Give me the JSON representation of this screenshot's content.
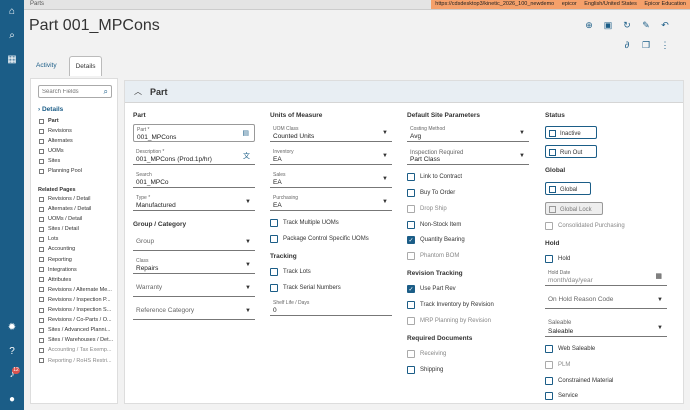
{
  "topbar": {
    "breadcrumb": "Parts",
    "url": "https://cdsdesktop3/kinetic_2026_100_newdemo",
    "user": "epicor",
    "language": "English/United States",
    "company": "Epicor Education"
  },
  "leftnav": {
    "notification_count": "12"
  },
  "header": {
    "title": "Part 001_MPCons"
  },
  "tabs": [
    {
      "label": "Activity"
    },
    {
      "label": "Details"
    }
  ],
  "leftpanel": {
    "search_placeholder": "Search Fields",
    "details_label": "Details",
    "details_items": [
      {
        "label": "Part"
      },
      {
        "label": "Revisions"
      },
      {
        "label": "Alternates"
      },
      {
        "label": "UOMs"
      },
      {
        "label": "Sites"
      },
      {
        "label": "Planning Pool"
      }
    ],
    "related_label": "Related Pages",
    "related_items": [
      {
        "label": "Revisions / Detail"
      },
      {
        "label": "Alternates / Detail"
      },
      {
        "label": "UOMs / Detail"
      },
      {
        "label": "Sites / Detail"
      },
      {
        "label": "Lots"
      },
      {
        "label": "Accounting"
      },
      {
        "label": "Reporting"
      },
      {
        "label": "Integrations"
      },
      {
        "label": "Attributes"
      },
      {
        "label": "Revisions / Alternate Me..."
      },
      {
        "label": "Revisions / Inspection P..."
      },
      {
        "label": "Revisions / Inspection S..."
      },
      {
        "label": "Revisions / Co-Parts / O..."
      },
      {
        "label": "Sites / Advanced Planni..."
      },
      {
        "label": "Sites / Warehouses / Det..."
      },
      {
        "label": "Accounting / Tax Exemp..."
      },
      {
        "label": "Reporting / RoHS Restri..."
      }
    ]
  },
  "section": {
    "title": "Part"
  },
  "part_col": {
    "title": "Part",
    "part_label": "Part *",
    "part_value": "001_MPCons",
    "desc_label": "Description *",
    "desc_value": "001_MPCons (Prod.1p/hr)",
    "search_label": "Search",
    "search_value": "001_MPCo",
    "type_label": "Type *",
    "type_value": "Manufactured",
    "group_title": "Group / Category",
    "group_placeholder": "Group",
    "class_label": "Class",
    "class_value": "Repairs",
    "warranty_placeholder": "Warranty",
    "refcat_placeholder": "Reference Category"
  },
  "uom_col": {
    "title": "Units of Measure",
    "uom_class_label": "UOM Class",
    "uom_class_value": "Counted Units",
    "inventory_label": "Inventory",
    "inventory_value": "EA",
    "sales_label": "Sales",
    "sales_value": "EA",
    "purchasing_label": "Purchasing",
    "purchasing_value": "EA",
    "track_multiple": "Track Multiple UOMs",
    "package_control": "Package Control Specific UOMs",
    "tracking_title": "Tracking",
    "track_lots": "Track Lots",
    "track_serial": "Track Serial Numbers",
    "shelf_label": "Shelf Life / Days",
    "shelf_value": "0"
  },
  "site_col": {
    "title": "Default Site Parameters",
    "costing_label": "Costing Method",
    "costing_value": "Avg",
    "inspection_label": "Inspection Required",
    "inspection_value": "Part Class",
    "link_contract": "Link to Contract",
    "buy_to_order": "Buy To Order",
    "drop_ship": "Drop Ship",
    "non_stock": "Non-Stock Item",
    "quantity_bearing": "Quantity Bearing",
    "phantom_bom": "Phantom BOM",
    "revtrack_title": "Revision Tracking",
    "use_part_rev": "Use Part Rev",
    "track_inv_rev": "Track Inventory by Revision",
    "mrp_planning": "MRP Planning by Revision",
    "reqdocs_title": "Required Documents",
    "receiving": "Receiving",
    "shipping": "Shipping"
  },
  "status_col": {
    "title": "Status",
    "inactive": "Inactive",
    "run_out": "Run Out",
    "global_title": "Global",
    "global": "Global",
    "global_lock": "Global Lock",
    "consolidated": "Consolidated Purchasing",
    "hold_title": "Hold",
    "hold": "Hold",
    "hold_date_label": "Hold Date",
    "hold_date_placeholder": "month/day/year",
    "on_hold_reason": "On Hold Reason Code",
    "saleable_label": "Saleable",
    "saleable_value": "Saleable",
    "web_saleable": "Web Saleable",
    "plm": "PLM",
    "constrained": "Constrained Material",
    "service": "Service"
  }
}
